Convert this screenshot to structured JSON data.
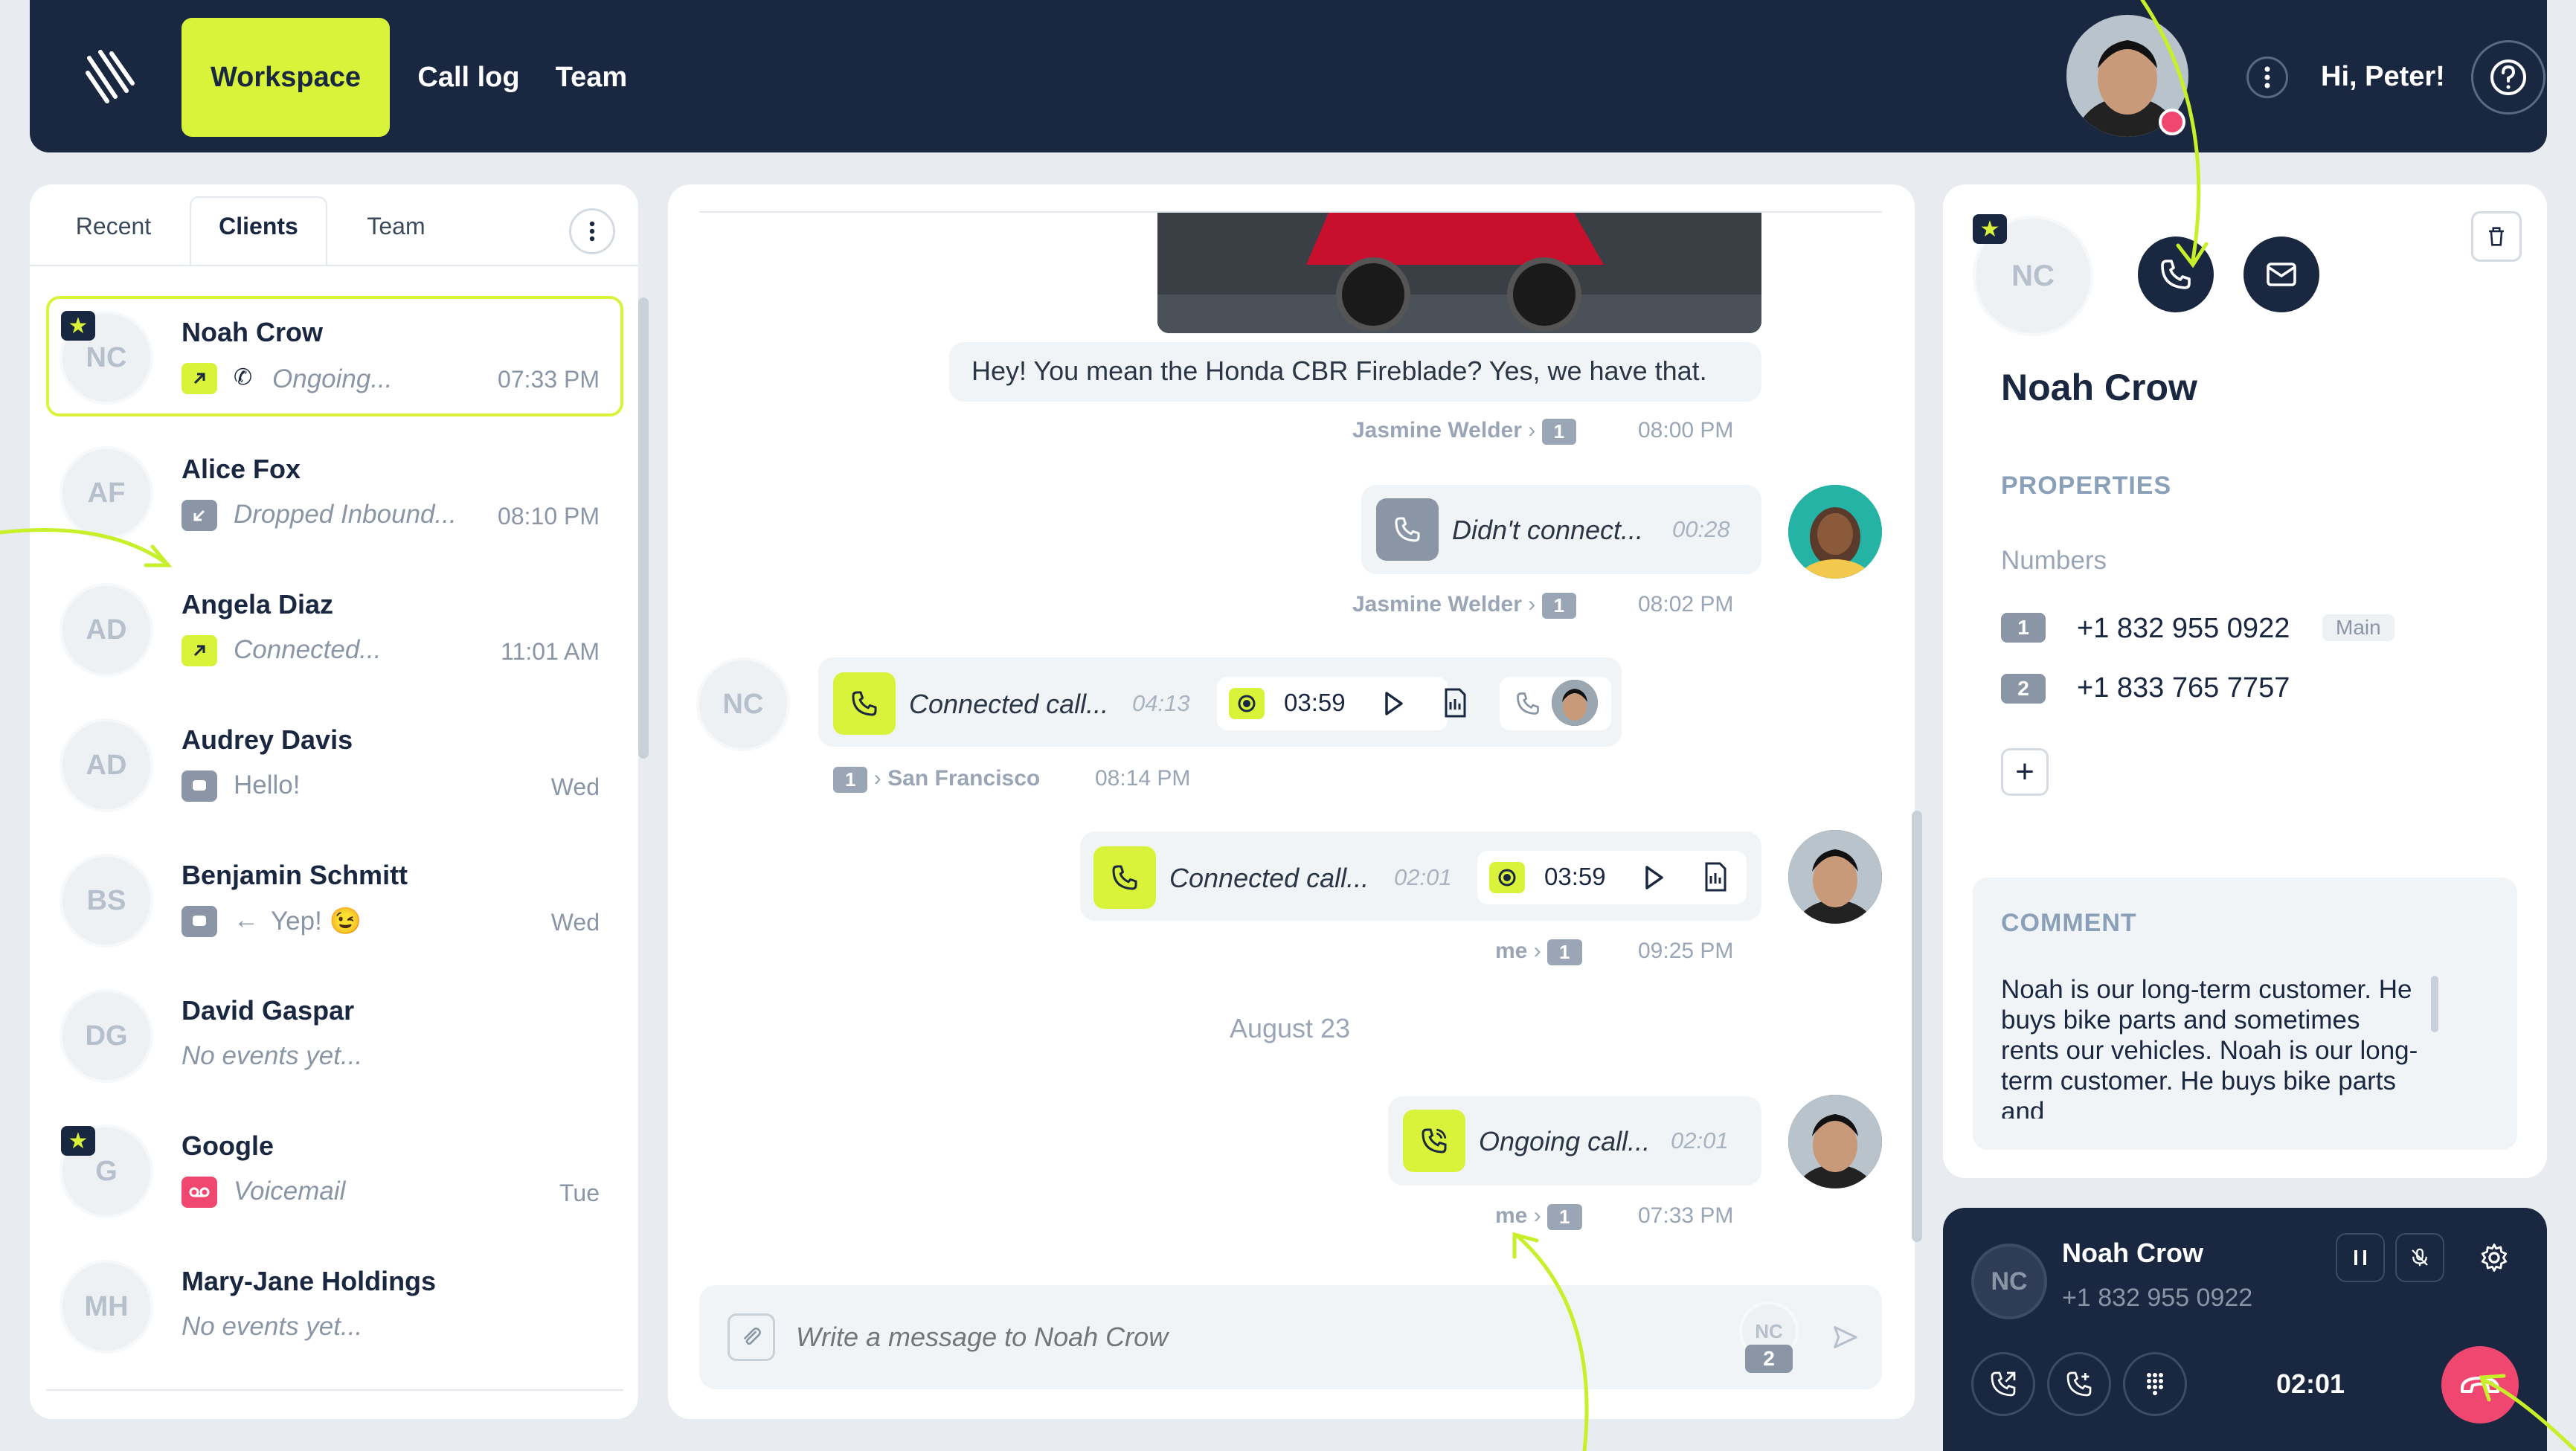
{
  "header": {
    "nav": [
      "Workspace",
      "Call log",
      "Team"
    ],
    "greeting": "Hi, Peter!"
  },
  "sidebar": {
    "tabs": [
      "Recent",
      "Clients",
      "Team"
    ],
    "contacts": [
      {
        "initials": "NC",
        "name": "Noah Crow",
        "status": "Ongoing...",
        "time": "07:33 PM",
        "starred": true
      },
      {
        "initials": "AF",
        "name": "Alice Fox",
        "status": "Dropped Inbound...",
        "time": "08:10 PM"
      },
      {
        "initials": "AD",
        "name": "Angela Diaz",
        "status": "Connected...",
        "time": "11:01 AM"
      },
      {
        "initials": "AD",
        "name": "Audrey Davis",
        "status": "Hello!",
        "time": "Wed"
      },
      {
        "initials": "BS",
        "name": "Benjamin Schmitt",
        "status": "Yep! 😉",
        "time": "Wed"
      },
      {
        "initials": "DG",
        "name": "David Gaspar",
        "status": "No events yet...",
        "time": ""
      },
      {
        "initials": "G",
        "name": "Google",
        "status": "Voicemail",
        "time": "Tue",
        "starred": true
      },
      {
        "initials": "MH",
        "name": "Mary-Jane Holdings",
        "status": "No events yet...",
        "time": ""
      }
    ]
  },
  "chat": {
    "msg1_text": "Hey! You mean the Honda CBR Fireblade? Yes, we have that.",
    "msg1_author": "Jasmine Welder",
    "msg1_line": "1",
    "msg1_time": "08:00 PM",
    "msg2_text": "Didn't connect...",
    "msg2_dur": "00:28",
    "msg2_author": "Jasmine Welder",
    "msg2_line": "1",
    "msg2_time": "08:02 PM",
    "msg3_avatar": "NC",
    "msg3_text": "Connected call...",
    "msg3_dur": "04:13",
    "msg3_rec": "03:59",
    "msg3_line": "1",
    "msg3_location": "San Francisco",
    "msg3_time": "08:14 PM",
    "msg4_text": "Connected call...",
    "msg4_dur": "02:01",
    "msg4_rec": "03:59",
    "msg4_author": "me",
    "msg4_line": "1",
    "msg4_time": "09:25 PM",
    "date_divider": "August 23",
    "msg5_text": "Ongoing call...",
    "msg5_dur": "02:01",
    "msg5_author": "me",
    "msg5_line": "1",
    "msg5_time": "07:33 PM",
    "composer_placeholder": "Write a message to Noah Crow",
    "composer_avatar": "NC",
    "composer_line": "2"
  },
  "details": {
    "initials": "NC",
    "name": "Noah Crow",
    "properties_label": "PROPERTIES",
    "numbers_label": "Numbers",
    "numbers": [
      {
        "index": "1",
        "value": "+1 832 955 0922",
        "tag": "Main"
      },
      {
        "index": "2",
        "value": "+1 833 765 7757"
      }
    ],
    "comment_label": "COMMENT",
    "comment": "Noah is our long-term customer. He buys bike parts and sometimes rents our vehicles. Noah is our long-term customer. He buys bike parts and"
  },
  "call_widget": {
    "initials": "NC",
    "name": "Noah Crow",
    "number": "+1 832 955 0922",
    "timer": "02:01"
  },
  "colors": {
    "accent": "#d9f33b",
    "navy": "#1a2740",
    "hangup": "#ef476f"
  }
}
